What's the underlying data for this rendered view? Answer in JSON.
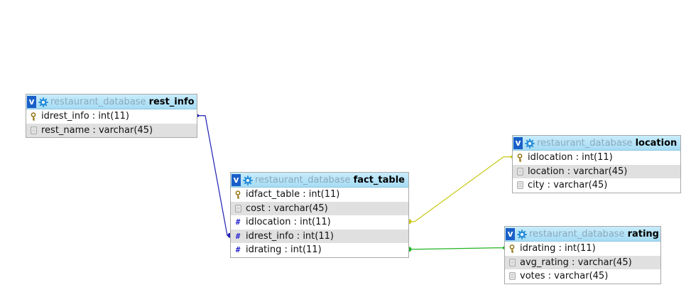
{
  "tables": [
    {
      "id": "rest_info",
      "database": "restaurant_database",
      "name": "rest_info",
      "toggle": "v",
      "icon": "gear-icon",
      "fields": [
        {
          "label": "idrest_info : int(11)",
          "icon": "key-icon"
        },
        {
          "label": "rest_name : varchar(45)",
          "icon": "field-icon"
        }
      ]
    },
    {
      "id": "fact_table",
      "database": "restaurant_database",
      "name": "fact_table",
      "toggle": "v",
      "icon": "gear-icon",
      "fields": [
        {
          "label": "idfact_table : int(11)",
          "icon": "key-icon"
        },
        {
          "label": "cost : varchar(45)",
          "icon": "field-icon"
        },
        {
          "label": "idlocation : int(11)",
          "icon": "hash-icon"
        },
        {
          "label": "idrest_info : int(11)",
          "icon": "hash-icon"
        },
        {
          "label": "idrating : int(11)",
          "icon": "hash-icon"
        }
      ]
    },
    {
      "id": "location",
      "database": "restaurant_database",
      "name": "location",
      "toggle": "v",
      "icon": "gear-icon",
      "fields": [
        {
          "label": "idlocation : int(11)",
          "icon": "key-icon"
        },
        {
          "label": "location : varchar(45)",
          "icon": "field-icon"
        },
        {
          "label": "city : varchar(45)",
          "icon": "field-icon"
        }
      ]
    },
    {
      "id": "rating",
      "database": "restaurant_database",
      "name": "rating",
      "toggle": "v",
      "icon": "gear-icon",
      "fields": [
        {
          "label": "idrating : int(11)",
          "icon": "key-icon"
        },
        {
          "label": "avg_rating : varchar(45)",
          "icon": "field-icon"
        },
        {
          "label": "votes : varchar(45)",
          "icon": "field-icon"
        }
      ]
    }
  ],
  "relations": [
    {
      "from_table": "fact_table",
      "from_field": "idrest_info",
      "to_table": "rest_info",
      "to_field": "idrest_info",
      "color": "#1f1fb4"
    },
    {
      "from_table": "fact_table",
      "from_field": "idlocation",
      "to_table": "location",
      "to_field": "idlocation",
      "color": "#c8c818"
    },
    {
      "from_table": "fact_table",
      "from_field": "idrating",
      "to_table": "rating",
      "to_field": "idrating",
      "color": "#22b422"
    }
  ],
  "colors": {
    "header_bg": "#b4e2f7",
    "toggle_bg": "#1a5fc8",
    "db_text": "#8aa9bd",
    "alt_row": "#e0e0e0"
  }
}
